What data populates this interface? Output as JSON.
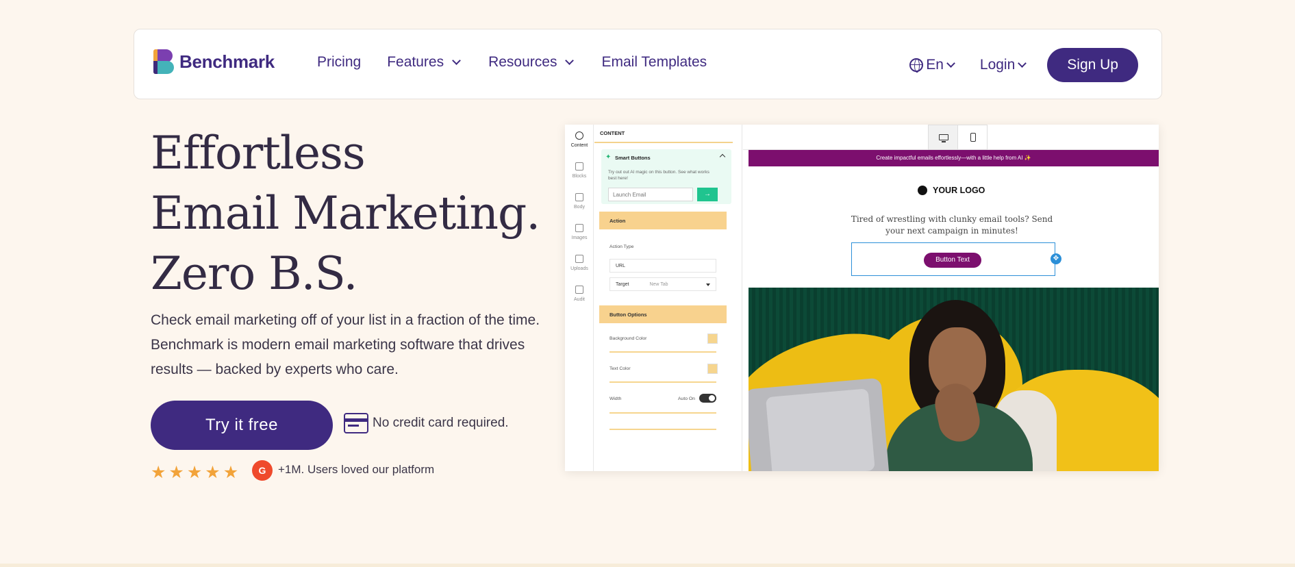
{
  "brand": {
    "name": "Benchmark"
  },
  "nav": {
    "items": [
      {
        "label": "Pricing",
        "dropdown": false
      },
      {
        "label": "Features",
        "dropdown": true
      },
      {
        "label": "Resources",
        "dropdown": true
      },
      {
        "label": "Email Templates",
        "dropdown": false
      }
    ],
    "language": "En",
    "login": "Login",
    "signup": "Sign Up"
  },
  "hero": {
    "headline_lines": [
      "Effortless",
      "Email Marketing.",
      "Zero B.S."
    ],
    "subcopy": "Check email marketing off of your list in a fraction of the time. Benchmark is modern email marketing software that drives results — backed by experts who care.",
    "cta": "Try it free",
    "no_card": "No credit card required.",
    "rating_stars": 5,
    "g2_label": "G",
    "users_text": "+1M. Users loved our platform"
  },
  "editor": {
    "rail": [
      "Content",
      "Blocks",
      "Body",
      "Images",
      "Uploads",
      "Audit"
    ],
    "panel_title": "CONTENT",
    "smart_buttons": {
      "title": "Smart Buttons",
      "desc": "Try out out AI magic on this button. See what works best here!",
      "placeholder": "Launch Email",
      "go": "→"
    },
    "action": {
      "title": "Action",
      "type_label": "Action Type",
      "type_value": "URL",
      "target_label": "Target",
      "target_value": "New Tab"
    },
    "button_options": {
      "title": "Button Options",
      "bg_color": "Background Color",
      "text_color": "Text Color",
      "width": "Width",
      "auto_on": "Auto On"
    },
    "email": {
      "banner": "Create impactful emails effortlessly—with a little help from AI ✨",
      "logo": "YOUR LOGO",
      "copy": "Tired of wrestling with clunky email tools? Send your next campaign in minutes!",
      "button": "Button Text"
    }
  },
  "colors": {
    "brand_purple": "#3f2a80",
    "email_purple": "#7c0f6e",
    "section_yellow": "#f8d28e",
    "accent_green": "#20c48f",
    "star": "#f2a33a"
  }
}
